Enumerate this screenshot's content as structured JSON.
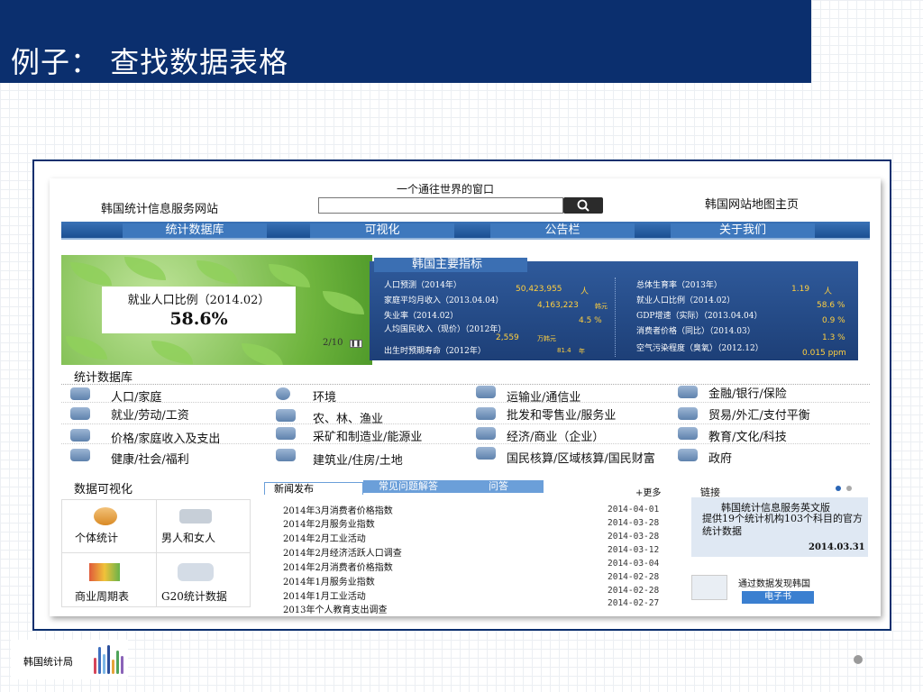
{
  "slide": {
    "title": "例子： 查找数据表格",
    "footer_logo_text": "韩国统计局"
  },
  "site": {
    "slogan": "一个通往世界的窗口",
    "name": "韩国统计信息服务网站",
    "map_link": "韩国网站地图主页",
    "nav": [
      "统计数据库",
      "可视化",
      "公告栏",
      "关于我们"
    ],
    "feature": {
      "label": "就业人口比例（2014.02）",
      "value": "58.6%",
      "pager": "2/10"
    },
    "indicators": {
      "title": "韩国主要指标",
      "left": [
        {
          "label": "人口预测（2014年）",
          "value": "50,423,955",
          "unit": "人"
        },
        {
          "label": "家庭平均月收入（2013.04.04）",
          "value": "4,163,223",
          "unit": "韩元"
        },
        {
          "label": "失业率（2014.02）",
          "value": "4.5 %",
          "unit": ""
        },
        {
          "label": "人均国民收入（现价）（2012年）",
          "value": "2,559",
          "unit": "万韩元"
        },
        {
          "label": "出生时预期寿命（2012年）",
          "value": "81.4",
          "unit": "年"
        }
      ],
      "right": [
        {
          "label": "总体生育率（2013年）",
          "value": "1.19",
          "unit": "人"
        },
        {
          "label": "就业人口比例（2014.02）",
          "value": "58.6 %",
          "unit": ""
        },
        {
          "label": "GDP增速（实际）（2013.04.04）",
          "value": "0.9 %",
          "unit": ""
        },
        {
          "label": "消费者价格（同比）（2014.03）",
          "value": "1.3 %",
          "unit": ""
        },
        {
          "label": "空气污染程度（臭氧）（2012.12）",
          "value": "0.015 ppm",
          "unit": ""
        }
      ]
    },
    "database": {
      "title": "统计数据库",
      "categories": [
        [
          "人口/家庭",
          "环境",
          "运输业/通信业",
          "金融/银行/保险"
        ],
        [
          "就业/劳动/工资",
          "农、林、渔业",
          "批发和零售业/服务业",
          "贸易/外汇/支付平衡"
        ],
        [
          "价格/家庭收入及支出",
          "采矿和制造业/能源业",
          "经济/商业（企业）",
          "教育/文化/科技"
        ],
        [
          "健康/社会/福利",
          "建筑业/住房/土地",
          "国民核算/区域核算/国民财富",
          "政府"
        ]
      ]
    },
    "visualization": {
      "title": "数据可视化",
      "items": [
        "个体统计",
        "男人和女人",
        "商业周期表",
        "G20统计数据"
      ]
    },
    "news": {
      "tabs": [
        "新闻发布",
        "常见问题解答",
        "问答"
      ],
      "more": "+更多",
      "items": [
        {
          "title": "2014年3月消费者价格指数",
          "date": "2014-04-01"
        },
        {
          "title": "2014年2月服务业指数",
          "date": "2014-03-28"
        },
        {
          "title": "2014年2月工业活动",
          "date": "2014-03-28"
        },
        {
          "title": "2014年2月经济活跃人口调查",
          "date": "2014-03-12"
        },
        {
          "title": "2014年2月消费者价格指数",
          "date": "2014-03-04"
        },
        {
          "title": "2014年1月服务业指数",
          "date": "2014-02-28"
        },
        {
          "title": "2014年1月工业活动",
          "date": "2014-02-28"
        },
        {
          "title": "2013年个人教育支出调查",
          "date": "2014-02-27"
        }
      ]
    },
    "links": {
      "title": "链接",
      "english_site_title": "韩国统计信息服务英文版",
      "english_site_desc": "提供19个统计机构103个科目的官方统计数据",
      "english_site_date": "2014.03.31",
      "discover_title": "通过数据发现韩国",
      "ebook_label": "电子书"
    }
  },
  "colors": {
    "title_bar": "#0b2f6e",
    "nav_blue": "#3e78bd",
    "indicator_bg": "#1d3f77",
    "indicator_value": "#ffcf3f"
  }
}
